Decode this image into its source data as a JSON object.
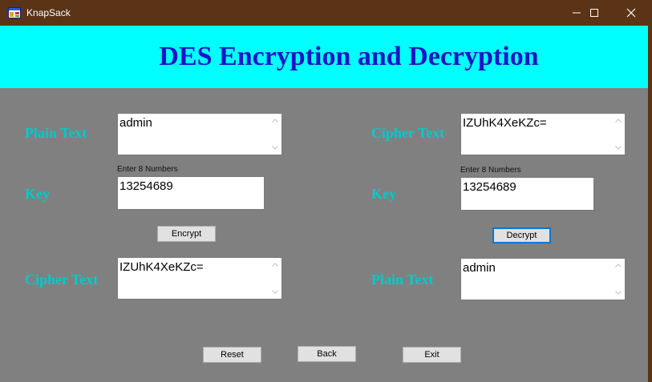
{
  "window": {
    "title": "KnapSack"
  },
  "header": {
    "title": "DES Encryption and Decryption"
  },
  "encrypt_panel": {
    "plain_label": "Plain Text",
    "plain_value": "admin",
    "key_hint": "Enter 8 Numbers",
    "key_label": "Key",
    "key_value": "13254689",
    "button_label": "Encrypt",
    "cipher_label": "Cipher Text",
    "cipher_value": "IZUhK4XeKZc="
  },
  "decrypt_panel": {
    "cipher_label": "Cipher Text",
    "cipher_value": "IZUhK4XeKZc=",
    "key_hint": "Enter 8 Numbers",
    "key_label": "Key",
    "key_value": "13254689",
    "button_label": "Decrypt",
    "plain_label": "Plain Text",
    "plain_value": "admin"
  },
  "footer": {
    "reset_label": "Reset",
    "back_label": "Back",
    "exit_label": "Exit"
  },
  "colors": {
    "title_bar": "#5b3316",
    "banner": "#00ffff",
    "banner_text": "#1616c8",
    "form_background": "#808080",
    "label_text": "#00cccc",
    "focus_border": "#0078d7"
  }
}
